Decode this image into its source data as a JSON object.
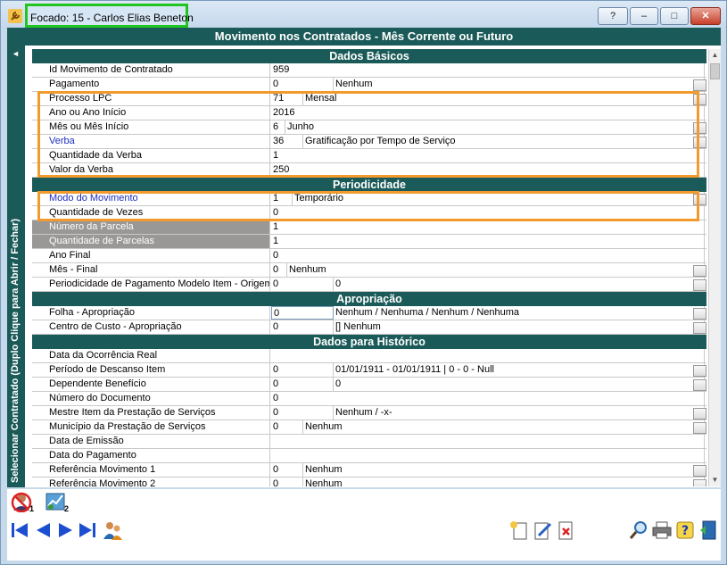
{
  "window": {
    "focused_label": "Focado:  15 - Carlos Elias Beneton",
    "help_label": "?",
    "minimize_label": "–",
    "maximize_label": "□",
    "close_label": "✕"
  },
  "form": {
    "title": "Movimento nos Contratados - Mês Corrente ou Futuro",
    "side_tab_label": "Selecionar Contratado (Duplo Clique para Abrir / Fechar)",
    "side_tab_arrow": "◄"
  },
  "sections": {
    "basic": "Dados Básicos",
    "periodicity": "Periodicidade",
    "appropriation": "Apropriação",
    "history": "Dados para Histórico"
  },
  "rows": {
    "id_movimento": {
      "label": "Id Movimento de Contratado",
      "value": "959"
    },
    "pagamento": {
      "label": "Pagamento",
      "code": "0",
      "desc": "Nenhum"
    },
    "processo_lpc": {
      "label": "Processo LPC",
      "code": "71",
      "desc": "Mensal"
    },
    "ano_inicio": {
      "label": "Ano ou Ano Início",
      "value": "2016"
    },
    "mes_inicio": {
      "label": "Mês ou Mês Início",
      "code": "6",
      "desc": "Junho"
    },
    "verba": {
      "label": "Verba",
      "code": "36",
      "desc": "Gratificação por Tempo de Serviço"
    },
    "qtd_verba": {
      "label": "Quantidade da Verba",
      "value": "1"
    },
    "valor_verba": {
      "label": "Valor da Verba",
      "value": "250"
    },
    "modo_movimento": {
      "label": "Modo do Movimento",
      "code": "1",
      "desc": "Temporário"
    },
    "qtd_vezes": {
      "label": "Quantidade de Vezes",
      "value": "0"
    },
    "numero_parcela": {
      "label": "Número da Parcela",
      "value": "1"
    },
    "qtd_parcelas": {
      "label": "Quantidade de Parcelas",
      "value": "1"
    },
    "ano_final": {
      "label": "Ano Final",
      "value": "0"
    },
    "mes_final": {
      "label": "Mês - Final",
      "code": "0",
      "desc": "Nenhum"
    },
    "periodicidade_pgto": {
      "label": "Periodicidade de Pagamento Modelo Item - Origem",
      "code": "0",
      "desc": "0"
    },
    "folha_apropriacao": {
      "label": "Folha - Apropriação",
      "code": "0",
      "desc": "Nenhum / Nenhuma / Nenhum / Nenhuma"
    },
    "centro_custo": {
      "label": "Centro de Custo - Apropriação",
      "code": "0",
      "desc": "[] Nenhum"
    },
    "data_ocorrencia": {
      "label": "Data da Ocorrência Real",
      "value": ""
    },
    "periodo_descanso": {
      "label": "Período de Descanso Item",
      "code": "0",
      "desc": "01/01/1911 - 01/01/1911  |  0 - 0 - Null"
    },
    "dependente_beneficio": {
      "label": "Dependente Benefício",
      "code": "0",
      "desc": "0"
    },
    "numero_documento": {
      "label": "Número do Documento",
      "value": "0"
    },
    "mestre_item": {
      "label": "Mestre Item da Prestação de Serviços",
      "code": "0",
      "desc": "Nenhum / -x-"
    },
    "municipio": {
      "label": "Município da Prestação de Serviços",
      "code": "0",
      "desc": "Nenhum"
    },
    "data_emissao": {
      "label": "Data de Emissão",
      "value": ""
    },
    "data_pagamento": {
      "label": "Data do Pagamento",
      "value": ""
    },
    "ref_movimento_1": {
      "label": "Referência Movimento 1",
      "code": "0",
      "desc": "Nenhum"
    },
    "ref_movimento_2": {
      "label": "Referência Movimento 2",
      "code": "0",
      "desc": "Nenhum"
    }
  },
  "toolbar": {
    "icon1_sub": "1",
    "icon2_sub": "2"
  },
  "colors": {
    "header_teal": "#1a5a58",
    "highlight_orange": "#f29a2e",
    "focus_green": "#21c421",
    "link_blue": "#1d2dbf"
  }
}
